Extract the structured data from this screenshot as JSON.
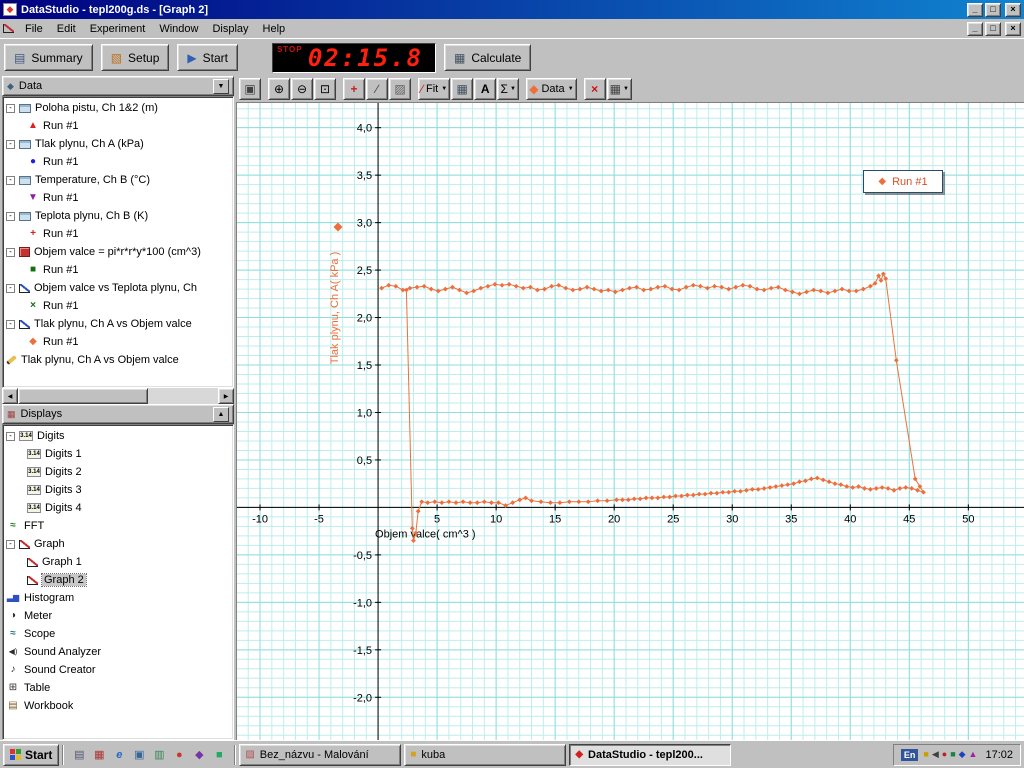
{
  "window": {
    "title": "DataStudio - tepl200g.ds - [Graph 2]",
    "menu": [
      "File",
      "Edit",
      "Experiment",
      "Window",
      "Display",
      "Help"
    ]
  },
  "icons": {
    "app": "◆",
    "document": "graph",
    "minimize": "_",
    "maximize": "□",
    "close": "×",
    "scroll_left": "◀",
    "scroll_right": "▶",
    "dropdown_arrow": "▼"
  },
  "toolbar": {
    "summary_icon": "▤",
    "summary_label": "Summary",
    "setup_icon": "▧",
    "setup_label": "Setup",
    "start_icon": "▶",
    "start_label": "Start",
    "timer_label": "STOP",
    "timer_value": "02:15.8",
    "calculate_icon": "▦",
    "calculate_label": "Calculate"
  },
  "graph_toolbar": {
    "buttons": [
      {
        "name": "scale-to-fit-button",
        "glyph": "▣",
        "color": "#404040"
      },
      {
        "name": "zoom-in-button",
        "glyph": "⊕",
        "sep_before": true
      },
      {
        "name": "zoom-out-button",
        "glyph": "⊖"
      },
      {
        "name": "zoom-select-button",
        "glyph": "⊡"
      },
      {
        "name": "smart-tool-button",
        "glyph": "+",
        "color": "#c02020",
        "bold": true,
        "sep_before": true
      },
      {
        "name": "slope-tool-button",
        "glyph": "∕",
        "color": "#404040"
      },
      {
        "name": "note-tool-button",
        "glyph": "▨",
        "color": "#606060"
      },
      {
        "name": "fit-menu-button",
        "glyph": "∕",
        "color": "#c02020",
        "label": "Fit",
        "dropdown": true,
        "sep_before": true
      },
      {
        "name": "calculate-tool-button",
        "glyph": "▦",
        "color": "#405060"
      },
      {
        "name": "text-tool-button",
        "glyph": "A",
        "bold": true
      },
      {
        "name": "statistics-menu-button",
        "glyph": "Σ",
        "dropdown": true
      },
      {
        "name": "data-menu-button",
        "glyph": "◆",
        "color": "#ee6f3c",
        "label": "Data",
        "dropdown": true,
        "sep_before": true
      },
      {
        "name": "delete-button",
        "glyph": "×",
        "color": "#cc1010",
        "bold": true,
        "sep_before": true
      },
      {
        "name": "graph-settings-button",
        "glyph": "▦",
        "color": "#404040",
        "dropdown": true
      }
    ]
  },
  "data_panel": {
    "header": "Data",
    "icon": "◆",
    "arrow": "▼",
    "items": [
      {
        "label": "Poloha pistu, Ch 1&2 (m)",
        "icon": "sensor",
        "runs": [
          {
            "label": "Run #1",
            "symbol": "▲",
            "color": "#e02020"
          }
        ]
      },
      {
        "label": "Tlak plynu, Ch A (kPa)",
        "icon": "sensor",
        "runs": [
          {
            "label": "Run #1",
            "symbol": "●",
            "color": "#2020e0"
          }
        ]
      },
      {
        "label": "Temperature, Ch B (°C)",
        "icon": "sensor",
        "runs": [
          {
            "label": "Run #1",
            "symbol": "▼",
            "color": "#9020a0"
          }
        ]
      },
      {
        "label": "Teplota plynu, Ch B (K)",
        "icon": "sensor",
        "runs": [
          {
            "label": "Run #1",
            "symbol": "+",
            "color": "#d02020"
          }
        ]
      },
      {
        "label": "Objem valce = pi*r*r*y*100 (cm^3)",
        "icon": "calculator",
        "runs": [
          {
            "label": "Run #1",
            "symbol": "■",
            "color": "#107010"
          }
        ]
      },
      {
        "label": "Objem valce vs Teplota plynu, Ch",
        "icon": "xy",
        "runs": [
          {
            "label": "Run #1",
            "symbol": "×",
            "color": "#107010"
          }
        ]
      },
      {
        "label": "Tlak plynu, Ch A vs Objem valce",
        "icon": "xy",
        "runs": [
          {
            "label": "Run #1",
            "symbol": "◆",
            "color": "#ee6f3c"
          }
        ]
      },
      {
        "label": "Tlak plynu, Ch A vs Objem valce",
        "icon": "pen",
        "runs": []
      }
    ]
  },
  "displays_panel": {
    "header": "Displays",
    "icon": "▦",
    "arrow": "▲",
    "items": [
      {
        "label": "Digits",
        "icon": "digits",
        "children": [
          "Digits 1",
          "Digits 2",
          "Digits 3",
          "Digits 4"
        ]
      },
      {
        "label": "FFT",
        "icon": "fft"
      },
      {
        "label": "Graph",
        "icon": "graph",
        "children": [
          "Graph 1",
          "Graph 2"
        ],
        "selected_child": "Graph 2"
      },
      {
        "label": "Histogram",
        "icon": "histogram"
      },
      {
        "label": "Meter",
        "icon": "meter"
      },
      {
        "label": "Scope",
        "icon": "scope"
      },
      {
        "label": "Sound Analyzer",
        "icon": "sound-analyzer"
      },
      {
        "label": "Sound Creator",
        "icon": "sound-creator"
      },
      {
        "label": "Table",
        "icon": "table"
      },
      {
        "label": "Workbook",
        "icon": "workbook"
      }
    ]
  },
  "tree_icon_text": {
    "digits": "3.14",
    "fft": "≈",
    "histogram": "▃▆",
    "meter": "◑",
    "scope": "≈",
    "sound-analyzer": "◀)",
    "sound-creator": "♪",
    "table": "⊞",
    "workbook": "▤"
  },
  "chart_data": {
    "type": "line",
    "title": "",
    "xlabel": "Objem valce( cm^3 )",
    "ylabel": "Tlak plynu, Ch A( kPa )",
    "xlim": [
      -11.95,
      54.8
    ],
    "ylim": [
      -2.45,
      4.26
    ],
    "grid": {
      "minor_color": "#bdeeec",
      "major_color": "#8fdedd",
      "minor_x": 1,
      "minor_y": 0.1,
      "major_x": 5,
      "major_y": 0.5
    },
    "xticks": [
      {
        "v": -10,
        "l": "-10"
      },
      {
        "v": -5,
        "l": "-5"
      },
      {
        "v": 5,
        "l": "5"
      },
      {
        "v": 10,
        "l": "10"
      },
      {
        "v": 15,
        "l": "15"
      },
      {
        "v": 20,
        "l": "20"
      },
      {
        "v": 25,
        "l": "25"
      },
      {
        "v": 30,
        "l": "30"
      },
      {
        "v": 35,
        "l": "35"
      },
      {
        "v": 40,
        "l": "40"
      },
      {
        "v": 45,
        "l": "45"
      },
      {
        "v": 50,
        "l": "50"
      }
    ],
    "yticks": [
      {
        "v": 4,
        "l": "4,0"
      },
      {
        "v": 3.5,
        "l": "3,5"
      },
      {
        "v": 3,
        "l": "3,0"
      },
      {
        "v": 2.5,
        "l": "2,5"
      },
      {
        "v": 2,
        "l": "2,0"
      },
      {
        "v": 1.5,
        "l": "1,5"
      },
      {
        "v": 1,
        "l": "1,0"
      },
      {
        "v": 0.5,
        "l": "0,5"
      },
      {
        "v": -0.5,
        "l": "-0,5"
      },
      {
        "v": -1,
        "l": "-1,0"
      },
      {
        "v": -1.5,
        "l": "-1,5"
      },
      {
        "v": -2,
        "l": "-2,0"
      }
    ],
    "legend": {
      "label": "Run #1",
      "symbol": "◆",
      "position": "top-right"
    },
    "series": [
      {
        "name": "Run #1",
        "color": "#ee6f3c",
        "marker": "diamond",
        "points": [
          [
            0.3,
            2.31
          ],
          [
            0.9,
            2.34
          ],
          [
            1.5,
            2.33
          ],
          [
            2.1,
            2.29
          ],
          [
            2.7,
            2.31
          ],
          [
            3.3,
            2.32
          ],
          [
            3.9,
            2.33
          ],
          [
            4.5,
            2.3
          ],
          [
            5.1,
            2.28
          ],
          [
            5.7,
            2.3
          ],
          [
            6.3,
            2.32
          ],
          [
            6.9,
            2.29
          ],
          [
            7.5,
            2.26
          ],
          [
            8.1,
            2.28
          ],
          [
            8.7,
            2.31
          ],
          [
            9.3,
            2.33
          ],
          [
            9.9,
            2.35
          ],
          [
            10.5,
            2.34
          ],
          [
            11.1,
            2.35
          ],
          [
            11.7,
            2.33
          ],
          [
            12.3,
            2.31
          ],
          [
            12.9,
            2.32
          ],
          [
            13.5,
            2.29
          ],
          [
            14.1,
            2.3
          ],
          [
            14.7,
            2.33
          ],
          [
            15.3,
            2.34
          ],
          [
            15.9,
            2.31
          ],
          [
            16.5,
            2.29
          ],
          [
            17.1,
            2.3
          ],
          [
            17.7,
            2.32
          ],
          [
            18.3,
            2.3
          ],
          [
            18.9,
            2.28
          ],
          [
            19.5,
            2.29
          ],
          [
            20.1,
            2.27
          ],
          [
            20.7,
            2.29
          ],
          [
            21.3,
            2.31
          ],
          [
            21.9,
            2.32
          ],
          [
            22.5,
            2.29
          ],
          [
            23.1,
            2.3
          ],
          [
            23.7,
            2.32
          ],
          [
            24.3,
            2.33
          ],
          [
            24.9,
            2.3
          ],
          [
            25.5,
            2.29
          ],
          [
            26.1,
            2.32
          ],
          [
            26.7,
            2.34
          ],
          [
            27.3,
            2.33
          ],
          [
            27.9,
            2.31
          ],
          [
            28.5,
            2.33
          ],
          [
            29.1,
            2.32
          ],
          [
            29.7,
            2.3
          ],
          [
            30.3,
            2.32
          ],
          [
            30.9,
            2.34
          ],
          [
            31.5,
            2.33
          ],
          [
            32.1,
            2.3
          ],
          [
            32.7,
            2.29
          ],
          [
            33.3,
            2.31
          ],
          [
            33.9,
            2.32
          ],
          [
            34.5,
            2.29
          ],
          [
            35.1,
            2.27
          ],
          [
            35.7,
            2.25
          ],
          [
            36.3,
            2.27
          ],
          [
            36.9,
            2.29
          ],
          [
            37.5,
            2.28
          ],
          [
            38.1,
            2.26
          ],
          [
            38.7,
            2.28
          ],
          [
            39.3,
            2.3
          ],
          [
            39.9,
            2.28
          ],
          [
            40.5,
            2.28
          ],
          [
            41.1,
            2.3
          ],
          [
            41.7,
            2.33
          ],
          [
            42.1,
            2.36
          ],
          [
            42.4,
            2.44
          ],
          [
            42.6,
            2.39
          ],
          [
            42.8,
            2.46
          ],
          [
            43.0,
            2.41
          ],
          [
            43.9,
            1.55
          ],
          [
            45.5,
            0.3
          ],
          [
            45.9,
            0.22
          ],
          [
            46.2,
            0.16
          ],
          [
            45.7,
            0.18
          ],
          [
            45.2,
            0.2
          ],
          [
            44.7,
            0.21
          ],
          [
            44.2,
            0.2
          ],
          [
            43.7,
            0.18
          ],
          [
            43.2,
            0.2
          ],
          [
            42.7,
            0.21
          ],
          [
            42.2,
            0.2
          ],
          [
            41.7,
            0.19
          ],
          [
            41.2,
            0.2
          ],
          [
            40.7,
            0.22
          ],
          [
            40.2,
            0.21
          ],
          [
            39.7,
            0.22
          ],
          [
            39.2,
            0.24
          ],
          [
            38.7,
            0.25
          ],
          [
            38.2,
            0.27
          ],
          [
            37.7,
            0.29
          ],
          [
            37.2,
            0.31
          ],
          [
            36.7,
            0.3
          ],
          [
            36.2,
            0.28
          ],
          [
            35.7,
            0.27
          ],
          [
            35.2,
            0.25
          ],
          [
            34.7,
            0.24
          ],
          [
            34.2,
            0.23
          ],
          [
            33.7,
            0.22
          ],
          [
            33.2,
            0.21
          ],
          [
            32.7,
            0.2
          ],
          [
            32.2,
            0.19
          ],
          [
            31.7,
            0.19
          ],
          [
            31.2,
            0.18
          ],
          [
            30.7,
            0.17
          ],
          [
            30.2,
            0.17
          ],
          [
            29.7,
            0.16
          ],
          [
            29.2,
            0.16
          ],
          [
            28.7,
            0.15
          ],
          [
            28.2,
            0.15
          ],
          [
            27.7,
            0.14
          ],
          [
            27.2,
            0.14
          ],
          [
            26.7,
            0.13
          ],
          [
            26.2,
            0.13
          ],
          [
            25.7,
            0.12
          ],
          [
            25.2,
            0.12
          ],
          [
            24.7,
            0.11
          ],
          [
            24.2,
            0.11
          ],
          [
            23.7,
            0.1
          ],
          [
            23.2,
            0.1
          ],
          [
            22.7,
            0.1
          ],
          [
            22.2,
            0.09
          ],
          [
            21.7,
            0.09
          ],
          [
            21.2,
            0.08
          ],
          [
            20.7,
            0.08
          ],
          [
            20.2,
            0.08
          ],
          [
            19.4,
            0.07
          ],
          [
            18.6,
            0.07
          ],
          [
            17.8,
            0.06
          ],
          [
            17,
            0.06
          ],
          [
            16.2,
            0.06
          ],
          [
            15.4,
            0.05
          ],
          [
            14.6,
            0.05
          ],
          [
            13.8,
            0.06
          ],
          [
            13,
            0.07
          ],
          [
            12.5,
            0.1
          ],
          [
            12,
            0.08
          ],
          [
            11.4,
            0.05
          ],
          [
            10.8,
            0.02
          ],
          [
            10.2,
            0.05
          ],
          [
            9.6,
            0.05
          ],
          [
            9,
            0.06
          ],
          [
            8.4,
            0.05
          ],
          [
            7.8,
            0.05
          ],
          [
            7.2,
            0.06
          ],
          [
            6.6,
            0.05
          ],
          [
            6,
            0.06
          ],
          [
            5.4,
            0.05
          ],
          [
            4.8,
            0.06
          ],
          [
            4.2,
            0.05
          ],
          [
            3.7,
            0.06
          ],
          [
            3.4,
            -0.04
          ],
          [
            3.2,
            -0.27
          ],
          [
            3.0,
            -0.35
          ],
          [
            2.9,
            -0.22
          ],
          [
            2.4,
            2.29
          ]
        ]
      }
    ]
  },
  "taskbar": {
    "start_label": "Start",
    "quicklaunch": [
      {
        "name": "show-desktop-icon",
        "glyph": "▤",
        "color": "#555577"
      },
      {
        "name": "notes-icon",
        "glyph": "▦",
        "color": "#aa3333"
      },
      {
        "name": "internet-explorer-icon",
        "glyph": "e",
        "color": "#2866c8",
        "bold": true
      },
      {
        "name": "mail-icon",
        "glyph": "▣",
        "color": "#336699"
      },
      {
        "name": "documents-icon",
        "glyph": "▥",
        "color": "#338855"
      },
      {
        "name": "browser-icon",
        "glyph": "●",
        "color": "#cc3333"
      },
      {
        "name": "media-icon",
        "glyph": "◆",
        "color": "#7733aa"
      },
      {
        "name": "tools-icon",
        "glyph": "■",
        "color": "#22aa66"
      }
    ],
    "tasks": [
      {
        "name": "task-paint",
        "label": "Bez_názvu - Malování",
        "glyph": "▨",
        "color": "#b05050",
        "active": false
      },
      {
        "name": "task-folder-kuba",
        "label": "kuba",
        "glyph": "■",
        "color": "#d8a020",
        "active": false
      },
      {
        "name": "task-datastudio",
        "label": "DataStudio - tepl200...",
        "glyph": "◆",
        "color": "#d02020",
        "active": true
      }
    ],
    "tray": {
      "lang": "En",
      "time": "17:02",
      "icons": [
        {
          "name": "tray-scheduler-icon",
          "glyph": "■",
          "color": "#c8a000"
        },
        {
          "name": "tray-volume-icon",
          "glyph": "◀",
          "color": "#404040"
        },
        {
          "name": "tray-antivirus-icon",
          "glyph": "●",
          "color": "#c02020"
        },
        {
          "name": "tray-display-icon",
          "glyph": "■",
          "color": "#208040"
        },
        {
          "name": "tray-network-icon",
          "glyph": "◆",
          "color": "#2040c0"
        },
        {
          "name": "tray-update-icon",
          "glyph": "▲",
          "color": "#a020a0"
        }
      ]
    }
  }
}
